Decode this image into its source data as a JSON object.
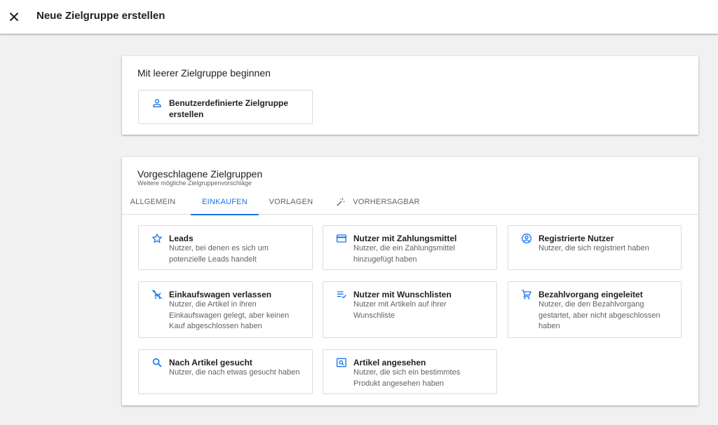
{
  "header": {
    "title": "Neue Zielgruppe erstellen",
    "close_icon": "close-icon"
  },
  "blank_section": {
    "title": "Mit leerer Zielgruppe beginnen",
    "custom_tile": {
      "icon": "person-icon",
      "label": "Benutzerdefinierte Zielgruppe erstellen"
    }
  },
  "suggested_section": {
    "title": "Vorgeschlagene Zielgruppen",
    "subtitle": "Weitere mögliche Zielgruppenvorschläge",
    "tabs": [
      {
        "label": "ALLGEMEIN",
        "active": false
      },
      {
        "label": "EINKAUFEN",
        "active": true
      },
      {
        "label": "VORLAGEN",
        "active": false
      },
      {
        "label": "VORHERSAGBAR",
        "active": false,
        "icon": "magic-wand-icon"
      }
    ],
    "tiles": [
      {
        "icon": "star-icon",
        "title": "Leads",
        "description": "Nutzer, bei denen es sich um potenzielle Leads handelt"
      },
      {
        "icon": "credit-card-icon",
        "title": "Nutzer mit Zahlungsmittel",
        "description": "Nutzer, die ein Zahlungsmittel hinzugefügt haben"
      },
      {
        "icon": "account-circle-icon",
        "title": "Registrierte Nutzer",
        "description": "Nutzer, die sich registriert haben"
      },
      {
        "icon": "remove-cart-icon",
        "title": "Einkaufswagen verlassen",
        "description": "Nutzer, die Artikel in ihren Einkaufswagen gelegt, aber keinen Kauf abgeschlossen haben"
      },
      {
        "icon": "playlist-check-icon",
        "title": "Nutzer mit Wunschlisten",
        "description": "Nutzer mit Artikeln auf ihrer Wunschliste"
      },
      {
        "icon": "shopping-cart-icon",
        "title": "Bezahlvorgang eingeleitet",
        "description": "Nutzer, die den Bezahlvorgang gestartet, aber nicht abgeschlossen haben"
      },
      {
        "icon": "search-icon",
        "title": "Nach Artikel gesucht",
        "description": "Nutzer, die nach etwas gesucht haben"
      },
      {
        "icon": "image-search-icon",
        "title": "Artikel angesehen",
        "description": "Nutzer, die sich ein bestimmtes Produkt angesehen haben"
      }
    ]
  },
  "colors": {
    "accent": "#1a73e8",
    "text": "#202124",
    "secondary_text": "#5f6368",
    "border": "#dadce0",
    "background": "#f1f1f1"
  }
}
